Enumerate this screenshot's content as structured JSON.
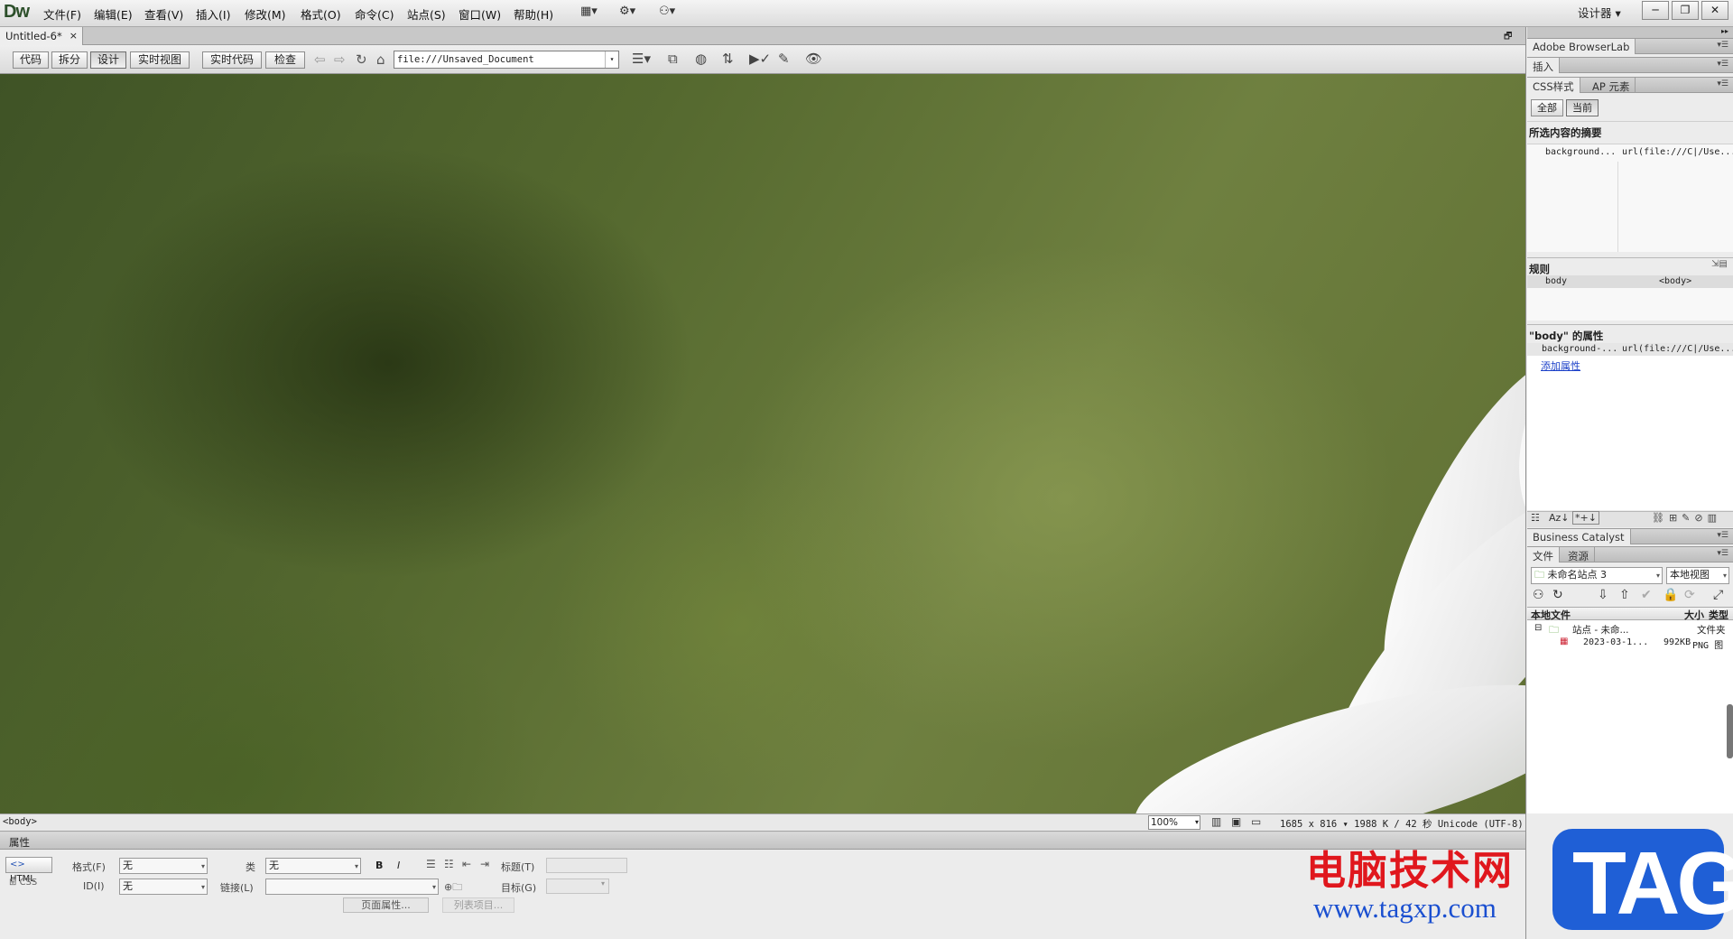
{
  "app": {
    "logo": "Dw",
    "workspace": "设计器",
    "workspace_caret": "▾",
    "win_min": "─",
    "win_restore": "❐",
    "win_close": "✕"
  },
  "menu": [
    "文件(F)",
    "编辑(E)",
    "查看(V)",
    "插入(I)",
    "修改(M)",
    "格式(O)",
    "命令(C)",
    "站点(S)",
    "窗口(W)",
    "帮助(H)"
  ],
  "toolbar_icons": {
    "layout": "▦▾",
    "settings": "⚙▾",
    "sync": "⚇▾"
  },
  "document": {
    "tab_title": "Untitled-6*",
    "tab_close": "×",
    "restore": "🗗"
  },
  "view_buttons": {
    "code": "代码",
    "split": "拆分",
    "design": "设计",
    "live_view": "实时视图",
    "live_code": "实时代码",
    "inspect": "检查"
  },
  "address": {
    "value": "file:///Unsaved_Document",
    "dd": "▾"
  },
  "status": {
    "tag": "<body>",
    "zoom": "100%",
    "zoom_dd": "▾",
    "dims": "1685 x 816 ▾ 1988 K / 42 秒 Unicode (UTF-8)"
  },
  "properties": {
    "title": "属性",
    "html_btn": "HTML",
    "css_btn": "CSS",
    "format_label": "格式(F)",
    "format_value": "无",
    "id_label": "ID(I)",
    "id_value": "无",
    "class_label": "类",
    "class_value": "无",
    "link_label": "链接(L)",
    "link_value": "",
    "bold": "B",
    "italic": "I",
    "title_label": "标题(T)",
    "target_label": "目标(G)",
    "page_props": "页面属性...",
    "list_item": "列表项目..."
  },
  "panels": {
    "browserlab": "Adobe BrowserLab",
    "insert": "插入",
    "css_tab": "CSS样式",
    "ap_tab": "AP 元素",
    "all": "全部",
    "current": "当前",
    "summary_title": "所选内容的摘要",
    "summary_prop": "background...",
    "summary_val": "url(file:///C|/Use...",
    "rules_title": "规则",
    "rule_sel": "body",
    "rule_tag": "<body>",
    "props_title": "\"body\" 的属性",
    "prop_name": "background-...",
    "prop_val": "url(file:///C|/Use...",
    "add_prop": "添加属性",
    "bc": "Business Catalyst",
    "files_tab": "文件",
    "assets_tab": "资源",
    "site": "未命名站点 3",
    "site_dd": "▾",
    "view": "本地视图",
    "view_dd": "▾",
    "col_local": "本地文件",
    "col_size": "大小",
    "col_type": "类型",
    "row1_name": "站点 - 未命...",
    "row1_type": "文件夹",
    "row2_name": "2023-03-1...",
    "row2_size": "992KB",
    "row2_type": "PNG 图",
    "tree_toggle": "⊟",
    "folder_icon": "🗀"
  },
  "watermark": {
    "cn": "电脑技术网",
    "url": "www.tagxp.com",
    "tag": "TAG"
  }
}
